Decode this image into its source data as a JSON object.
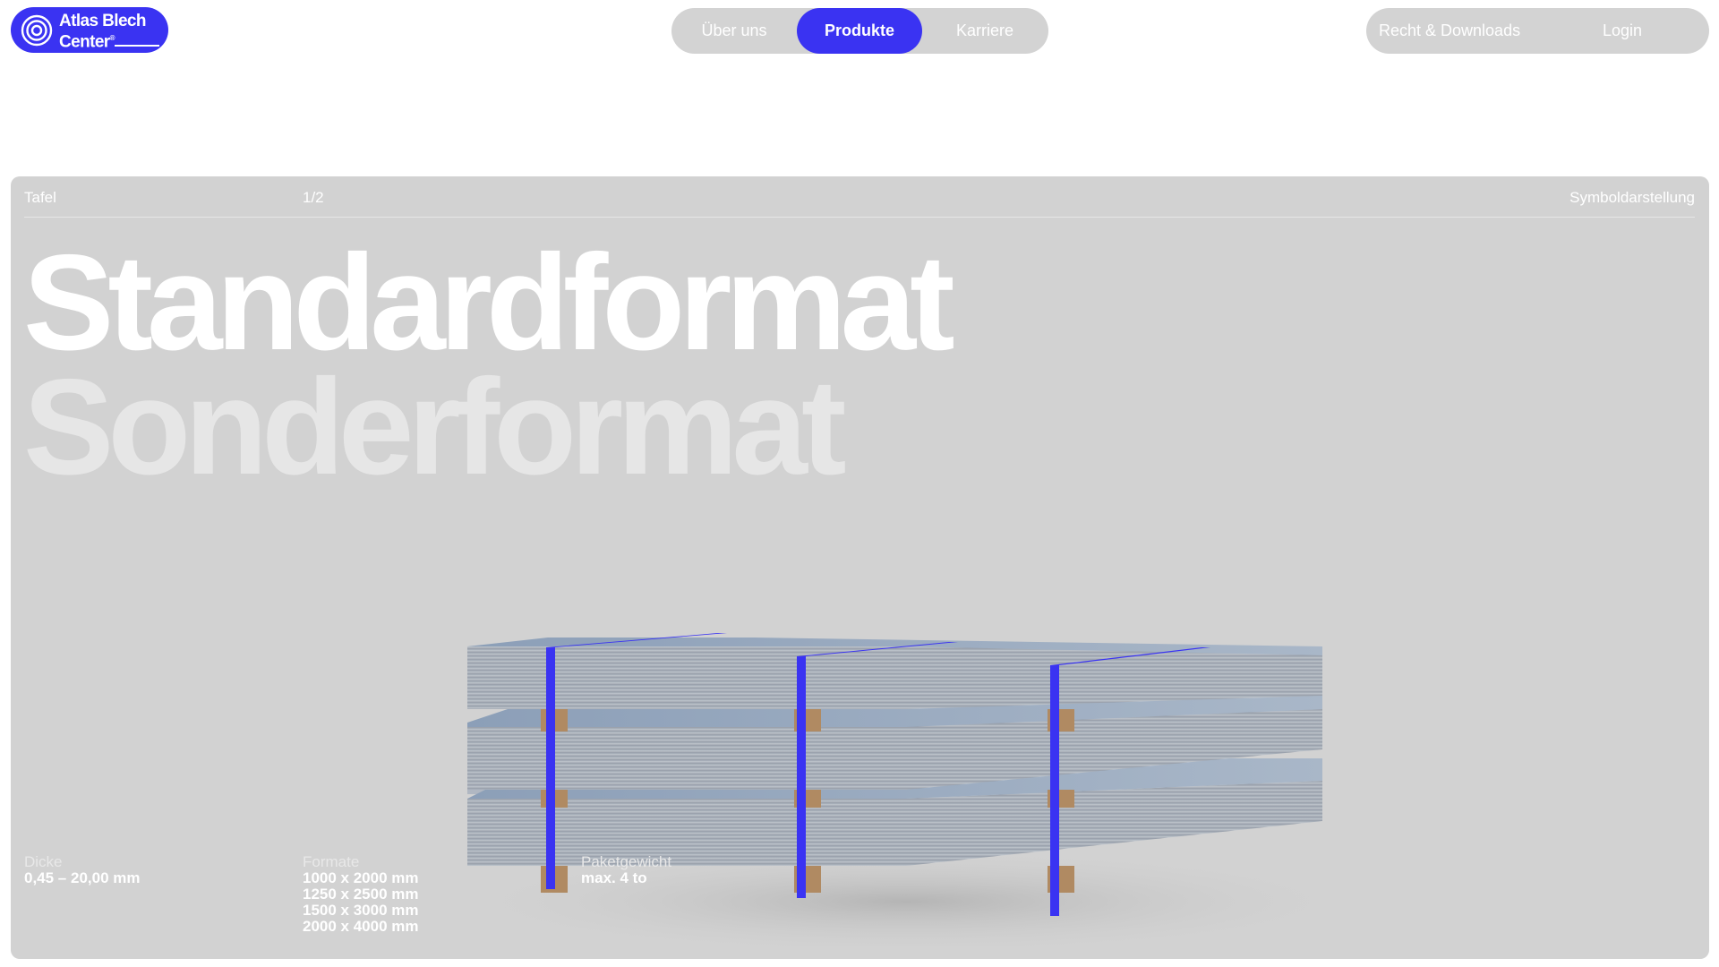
{
  "brand": {
    "name_line1": "Atlas Blech",
    "name_line2": "Center",
    "registered": "®",
    "color": "#3a33f2"
  },
  "nav": {
    "items": [
      {
        "label": "Über uns",
        "active": false
      },
      {
        "label": "Produkte",
        "active": true
      },
      {
        "label": "Karriere",
        "active": false
      }
    ]
  },
  "secondary_nav": {
    "items": [
      {
        "label": "Recht & Downloads"
      },
      {
        "label": "Login"
      }
    ]
  },
  "product": {
    "category": "Tafel",
    "pagination": "1/2",
    "image_note": "Symboldarstellung",
    "headline_primary": "Standardformat",
    "headline_secondary": "Sonderformat",
    "visual_icon": "sheet-metal-stack-icon",
    "specs": [
      {
        "label": "Dicke",
        "values": [
          "0,45 – 20,00 mm"
        ]
      },
      {
        "label": "Formate",
        "values": [
          "1000 x 2000 mm",
          "1250 x 2500 mm",
          "1500 x 3000 mm",
          "2000 x 4000 mm"
        ]
      },
      {
        "label": "Paketgewicht",
        "values": [
          "max. 4 to"
        ]
      }
    ]
  },
  "colors": {
    "accent": "#3a33f2",
    "panel": "#d2d2d2",
    "pill": "#d3d3d3"
  }
}
